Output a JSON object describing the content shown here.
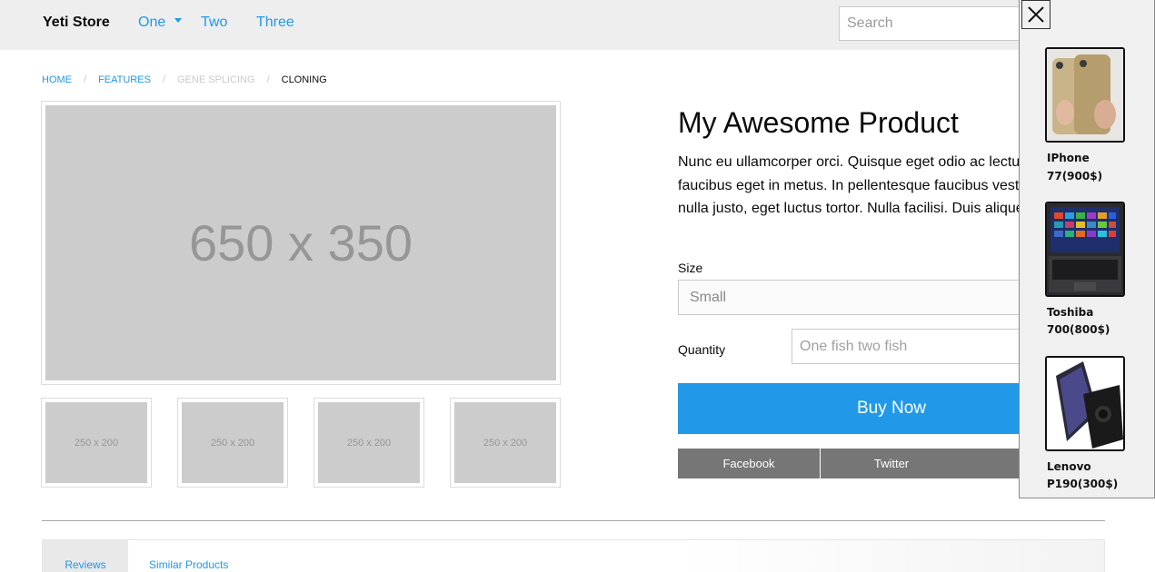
{
  "header": {
    "brand": "Yeti Store",
    "nav": [
      "One",
      "Two",
      "Three"
    ],
    "search_placeholder": "Search"
  },
  "breadcrumb": [
    "Home",
    "Features",
    "Gene Splicing",
    "Cloning"
  ],
  "gallery": {
    "main": "650 x 350",
    "thumbs": [
      "250 x 200",
      "250 x 200",
      "250 x 200",
      "250 x 200"
    ]
  },
  "product": {
    "title": "My Awesome Product",
    "description": "Nunc eu ullamcorper orci. Quisque eget odio ac lectus vestibulum faucibus eget in metus. In pellentesque faucibus vestibulum. Nulla at nulla justo, eget luctus tortor. Nulla facilisi. Duis aliquet egestas purus in.",
    "size_label": "Size",
    "size_value": "Small",
    "quantity_label": "Quantity",
    "quantity_placeholder": "One fish two fish",
    "buy_label": "Buy Now",
    "share": [
      "Facebook",
      "Twitter",
      ""
    ]
  },
  "tabs": [
    "Reviews",
    "Similar Products"
  ],
  "side_panel": {
    "items": [
      {
        "name": "IPhone",
        "price": "77(900$)",
        "icon": "phone-photo"
      },
      {
        "name": "Toshiba",
        "price": "700(800$)",
        "icon": "laptop-photo"
      },
      {
        "name": "Lenovo",
        "price": "P190(300$)",
        "icon": "phone-photo"
      }
    ]
  },
  "colors": {
    "accent": "#2199e8",
    "topbar": "#eeeeee",
    "share_button": "#767676",
    "placeholder": "#cccccc"
  }
}
